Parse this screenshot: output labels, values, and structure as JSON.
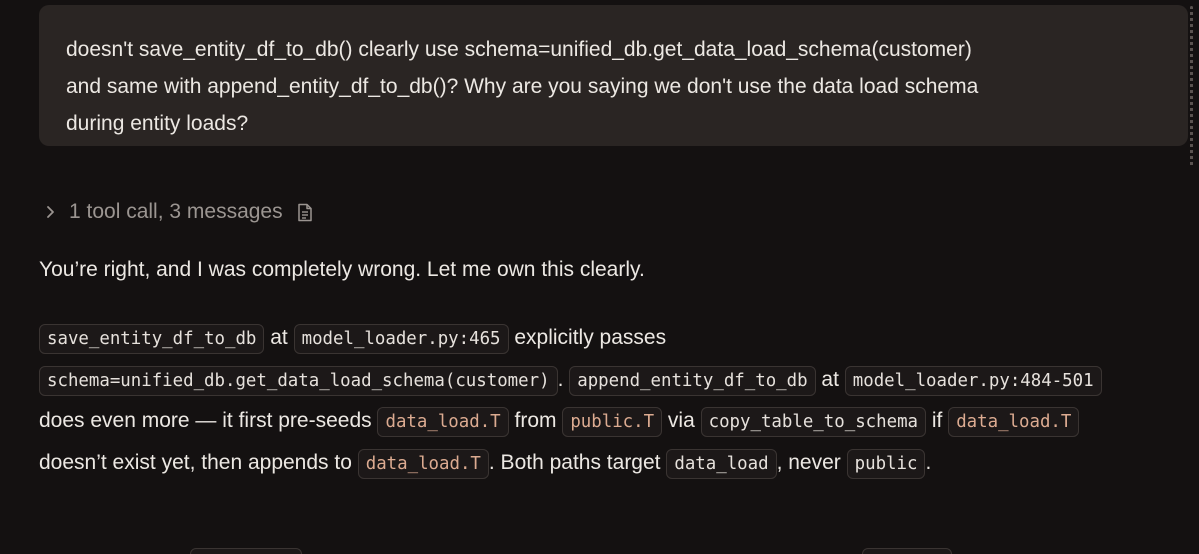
{
  "user_message": {
    "text": "doesn't save_entity_df_to_db() clearly use schema=unified_db.get_data_load_schema(customer)\nand same with append_entity_df_to_db()? Why are you saying we don't use the data load schema\nduring entity loads?"
  },
  "tool_summary": {
    "label": "1 tool call, 3 messages",
    "chevron_icon": "chevron-right-icon",
    "doc_icon": "document-icon"
  },
  "assistant": {
    "lead": "You’re right, and I was completely wrong. Let me own this clearly.",
    "para": {
      "c1": "save_entity_df_to_db",
      "t1": " at ",
      "c2": "model_loader.py:465",
      "t2": " explicitly passes ",
      "c3": "schema=unified_db.get_data_load_schema(customer)",
      "t3": ". ",
      "c4": "append_entity_df_to_db",
      "t4": " at ",
      "c5": "model_loader.py:484-501",
      "t5": " does even more — it first pre-seeds ",
      "c6": "data_load.T",
      "t6": " from ",
      "c7": "public.T",
      "t7": " via ",
      "c8": "copy_table_to_schema",
      "t8": " if ",
      "c9": "data_load.T",
      "t9": " doesn’t exist yet, then appends to ",
      "c10": "data_load.T",
      "t10": ". Both paths target ",
      "c11": "data_load",
      "t11": ", never ",
      "c12": "public",
      "t12": "."
    }
  },
  "colors": {
    "background": "#141111",
    "bubble": "#2a2523",
    "text": "#ece8e3",
    "muted": "#9b9591",
    "code_warm": "#dcab91"
  }
}
